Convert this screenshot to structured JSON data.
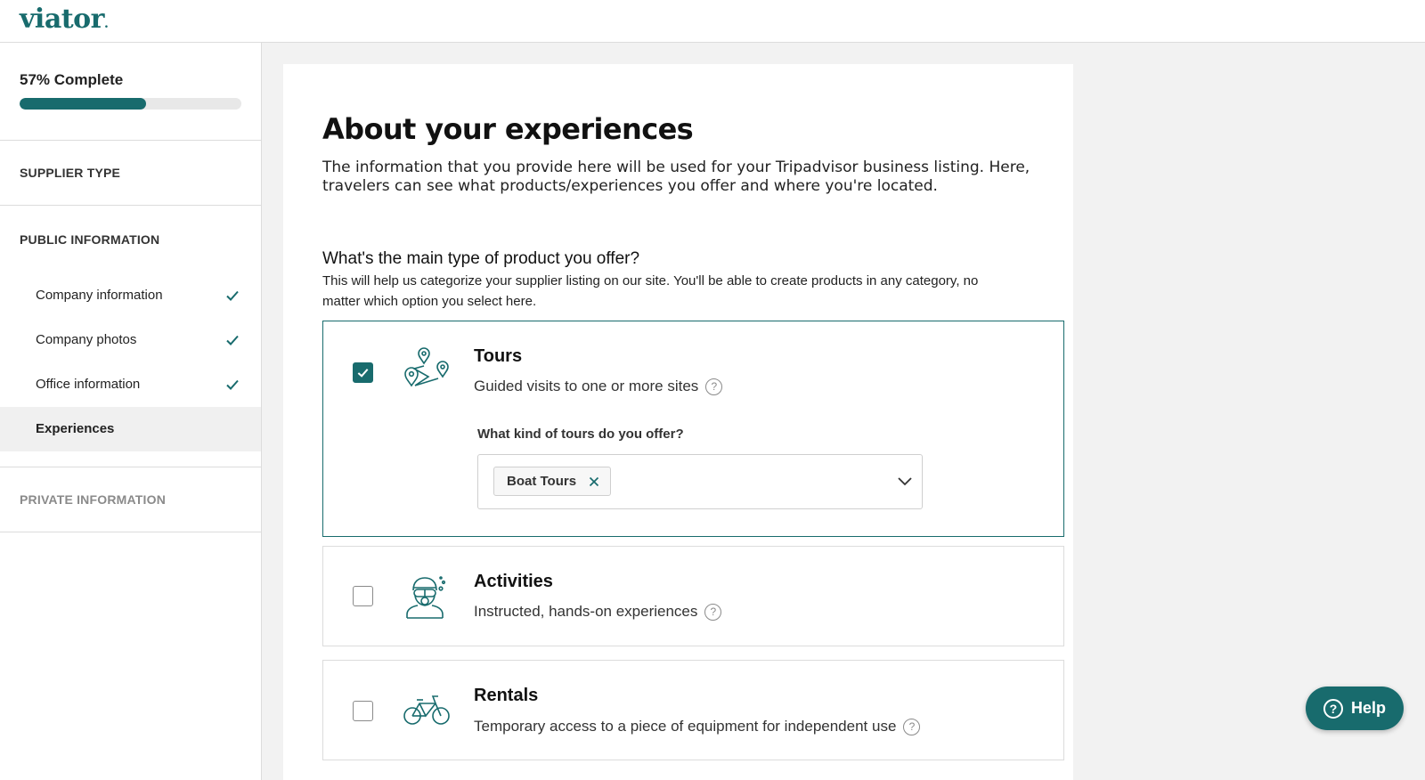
{
  "brand": {
    "logo_text": "viator",
    "accent": "#186b6d"
  },
  "sidebar": {
    "progress": {
      "label": "57% Complete",
      "percent": 57
    },
    "sections": {
      "supplier_type": "SUPPLIER TYPE",
      "public_information": "PUBLIC INFORMATION",
      "private_information": "PRIVATE INFORMATION"
    },
    "public_items": [
      {
        "label": "Company information",
        "completed": true,
        "icon": "check-icon"
      },
      {
        "label": "Company photos",
        "completed": true,
        "icon": "check-icon"
      },
      {
        "label": "Office information",
        "completed": true,
        "icon": "check-icon"
      },
      {
        "label": "Experiences",
        "completed": false,
        "active": true
      }
    ]
  },
  "main": {
    "title": "About your experiences",
    "description": "The information that you provide here will be used for your Tripadvisor business listing. Here, travelers can see what products/experiences you offer and where you're located.",
    "question": {
      "title": "What's the main type of product you offer?",
      "description": "This will help us categorize your supplier listing on our site. You'll be able to create products in any category, no matter which option you select here."
    },
    "options": [
      {
        "title": "Tours",
        "description": "Guided visits to one or more sites",
        "checked": true,
        "icon": "map-pins-icon",
        "sub_question": "What kind of tours do you offer?",
        "selected_tags": [
          "Boat Tours"
        ]
      },
      {
        "title": "Activities",
        "description": "Instructed, hands-on experiences",
        "checked": false,
        "icon": "diver-icon"
      },
      {
        "title": "Rentals",
        "description": "Temporary access to a piece of equipment for independent use",
        "checked": false,
        "icon": "bicycle-icon"
      }
    ]
  },
  "help_button": {
    "label": "Help",
    "icon": "question-circle-icon"
  }
}
